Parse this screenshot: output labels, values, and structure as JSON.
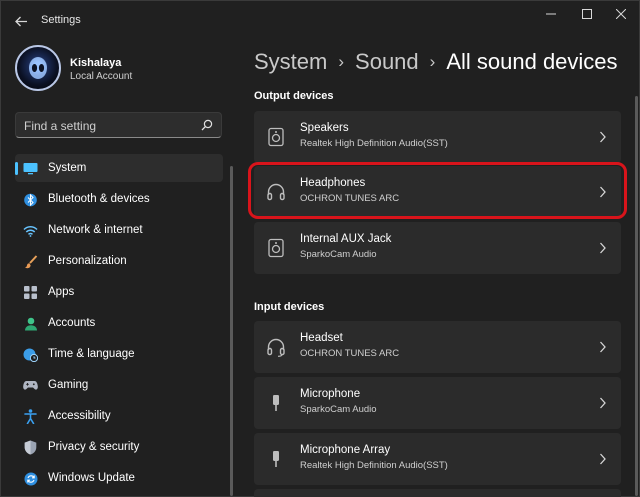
{
  "window": {
    "app_title": "Settings",
    "controls": {
      "minimize": "—",
      "maximize": "☐",
      "close": "✕"
    }
  },
  "profile": {
    "name": "Kishalaya",
    "account_type": "Local Account"
  },
  "search": {
    "placeholder": "Find a setting"
  },
  "sidebar": {
    "items": [
      {
        "label": "System",
        "icon": "monitor-icon",
        "active": true
      },
      {
        "label": "Bluetooth & devices",
        "icon": "bluetooth-icon"
      },
      {
        "label": "Network & internet",
        "icon": "wifi-icon"
      },
      {
        "label": "Personalization",
        "icon": "paintbrush-icon"
      },
      {
        "label": "Apps",
        "icon": "apps-grid-icon"
      },
      {
        "label": "Accounts",
        "icon": "person-icon"
      },
      {
        "label": "Time & language",
        "icon": "globe-clock-icon"
      },
      {
        "label": "Gaming",
        "icon": "gamepad-icon"
      },
      {
        "label": "Accessibility",
        "icon": "accessibility-icon"
      },
      {
        "label": "Privacy & security",
        "icon": "shield-icon"
      },
      {
        "label": "Windows Update",
        "icon": "update-icon"
      }
    ]
  },
  "breadcrumb": {
    "items": [
      "System",
      "Sound",
      "All sound devices"
    ],
    "separator": "›"
  },
  "output_devices": {
    "title": "Output devices",
    "items": [
      {
        "name": "Speakers",
        "detail": "Realtek High Definition Audio(SST)",
        "icon": "speaker-icon"
      },
      {
        "name": "Headphones",
        "detail": "OCHRON TUNES ARC",
        "icon": "headphones-icon",
        "highlighted": true
      },
      {
        "name": "Internal AUX Jack",
        "detail": "SparkoCam Audio",
        "icon": "speaker-icon"
      }
    ]
  },
  "input_devices": {
    "title": "Input devices",
    "items": [
      {
        "name": "Headset",
        "detail": "OCHRON TUNES ARC",
        "icon": "headset-icon"
      },
      {
        "name": "Microphone",
        "detail": "SparkoCam Audio",
        "icon": "microphone-icon"
      },
      {
        "name": "Microphone Array",
        "detail": "Realtek High Definition Audio(SST)",
        "icon": "microphone-icon"
      }
    ]
  },
  "colors": {
    "background": "#202020",
    "card": "#2b2b2b",
    "accent": "#4cc2ff",
    "highlight_border": "#d8141b"
  }
}
